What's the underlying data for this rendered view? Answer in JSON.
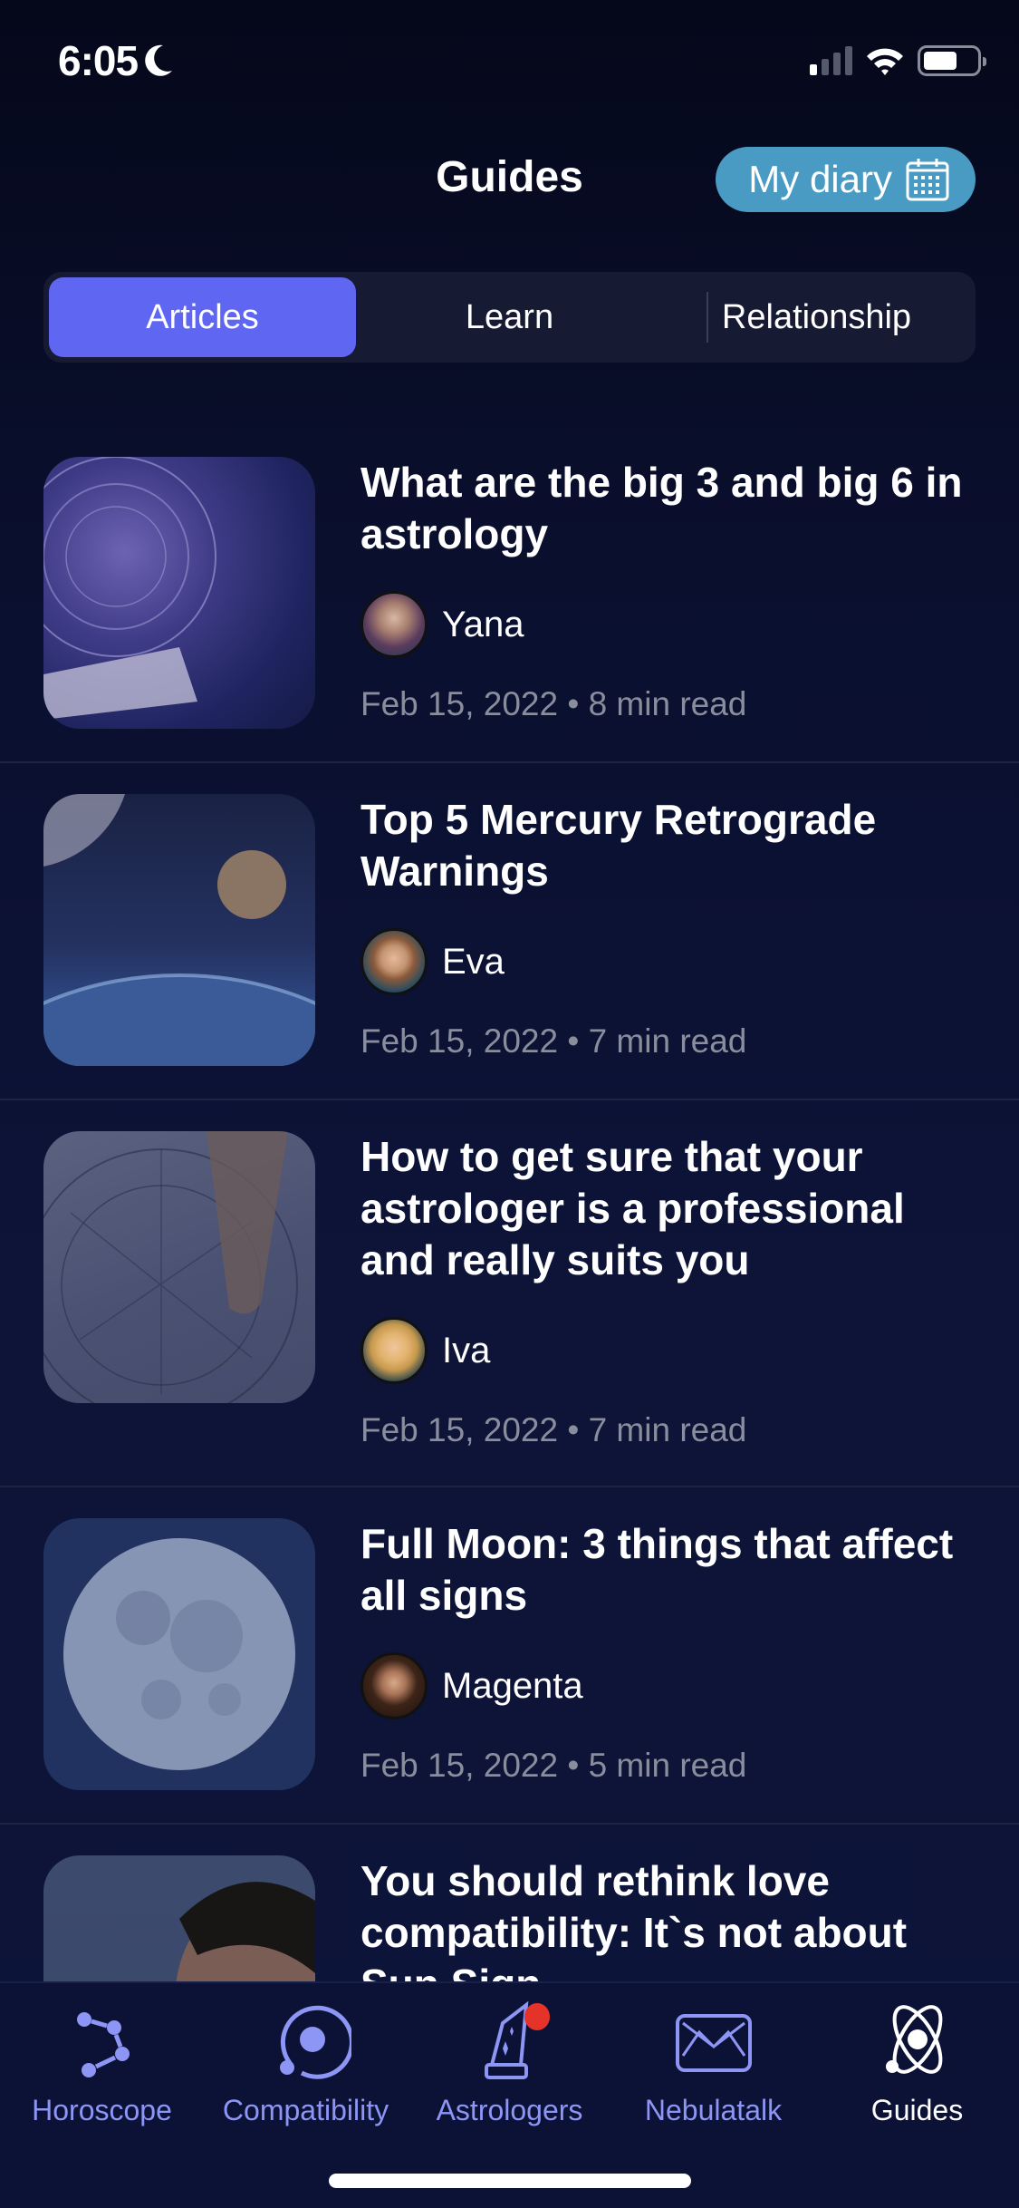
{
  "status_bar": {
    "time": "6:05",
    "focus_icon": "moon-icon",
    "signal_bars_on": 1,
    "signal_bars_total": 4,
    "battery_level": 0.65
  },
  "header": {
    "title": "Guides",
    "diary_button": {
      "label": "My diary",
      "icon": "calendar-icon"
    }
  },
  "segments": [
    {
      "label": "Articles",
      "active": true
    },
    {
      "label": "Learn",
      "active": false
    },
    {
      "label": "Relationship",
      "active": false
    }
  ],
  "articles": [
    {
      "title": "What are the big 3 and big 6 in astrology",
      "author": "Yana",
      "date": "Feb 15, 2022",
      "read_time": "8 min read",
      "meta": "Feb 15, 2022 • 8 min read",
      "thumb": "zodiac-wheel-book-image"
    },
    {
      "title": "Top 5 Mercury Retrograde Warnings",
      "author": "Eva",
      "date": "Feb 15, 2022",
      "read_time": "7 min read",
      "meta": "Feb 15, 2022 • 7 min read",
      "thumb": "planet-earth-moon-image"
    },
    {
      "title": "How to get sure that your astrologer is a professional and really suits you",
      "author": "Iva",
      "date": "Feb 15, 2022",
      "read_time": "7 min read",
      "meta": "Feb 15, 2022 • 7 min read",
      "thumb": "natal-chart-drawing-image"
    },
    {
      "title": "Full Moon: 3 things that affect all signs",
      "author": "Magenta",
      "date": "Feb 15, 2022",
      "read_time": "5 min read",
      "meta": "Feb 15, 2022 • 5 min read",
      "thumb": "full-moon-image"
    },
    {
      "title": "You should rethink love compatibility: It`s not about Sun Sign",
      "author": "",
      "date": "",
      "read_time": "",
      "meta": "",
      "thumb": "couple-kiss-image"
    }
  ],
  "tabbar": [
    {
      "label": "Horoscope",
      "icon": "constellation-icon",
      "active": false,
      "badge": false
    },
    {
      "label": "Compatibility",
      "icon": "orbit-icon",
      "active": false,
      "badge": false
    },
    {
      "label": "Astrologers",
      "icon": "wizard-hat-icon",
      "active": false,
      "badge": true
    },
    {
      "label": "Nebulatalk",
      "icon": "envelope-icon",
      "active": false,
      "badge": false
    },
    {
      "label": "Guides",
      "icon": "atom-icon",
      "active": true,
      "badge": false
    }
  ],
  "colors": {
    "accent": "#5f66f2",
    "diary_button": "#4a9bc4",
    "tab_inactive": "#8d95f5",
    "badge": "#e53329",
    "meta_text": "#8a8e9c"
  }
}
